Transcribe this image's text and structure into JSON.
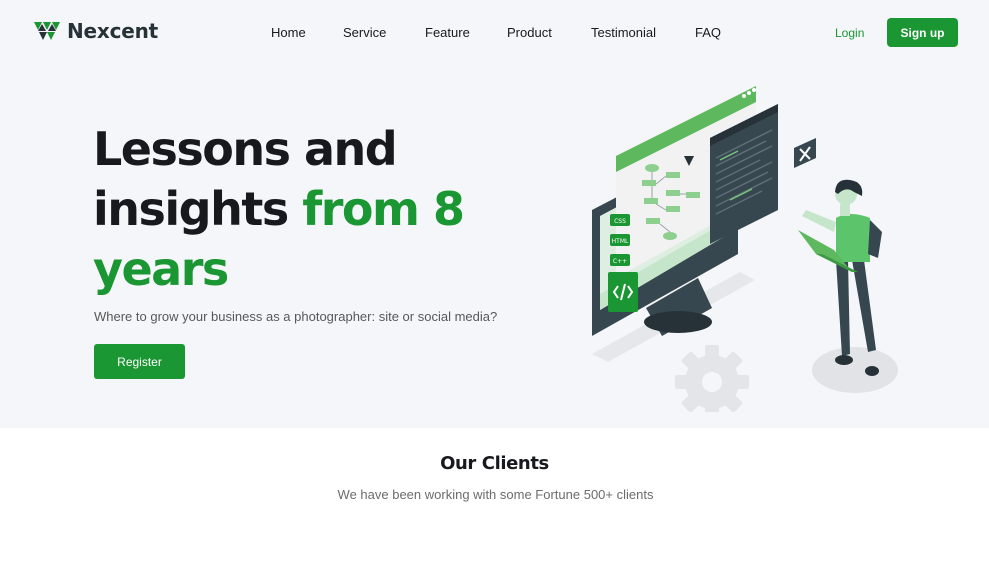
{
  "brand": {
    "name": "Nexcent"
  },
  "nav": {
    "items": [
      {
        "label": "Home"
      },
      {
        "label": "Service"
      },
      {
        "label": "Feature"
      },
      {
        "label": "Product"
      },
      {
        "label": "Testimonial"
      },
      {
        "label": "FAQ"
      }
    ],
    "login_label": "Login",
    "signup_label": "Sign up"
  },
  "hero": {
    "title_part1": "Lessons and insights",
    "title_part2": "from 8 years",
    "subtitle": "Where to grow your business as a photographer: site or social media?",
    "cta_label": "Register",
    "illustration_labels": [
      "CSS",
      "HTML",
      "C++"
    ]
  },
  "clients": {
    "title": "Our Clients",
    "subtitle": "We have been working with some Fortune 500+ clients"
  },
  "colors": {
    "accent": "#1a9632",
    "hero_background": "#f5f6f9",
    "text_dark": "#18191f",
    "logo_dark": "#263238"
  }
}
